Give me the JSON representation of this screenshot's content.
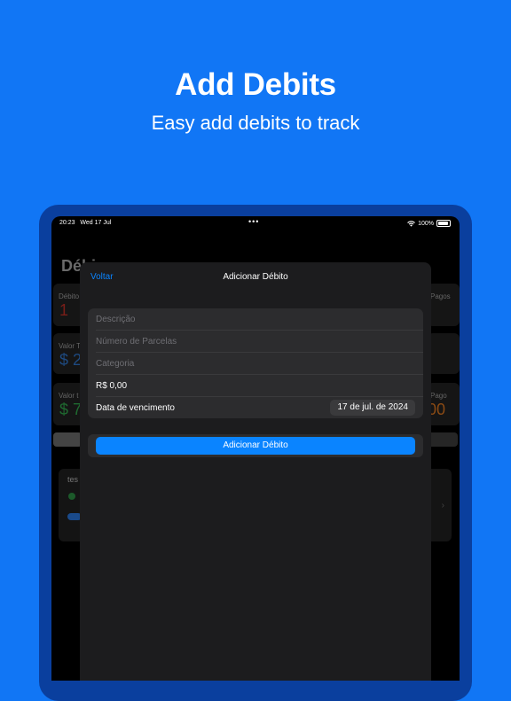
{
  "promo": {
    "title": "Add Debits",
    "subtitle": "Easy add debits to track"
  },
  "status_bar": {
    "time": "20:23",
    "date": "Wed 17 Jul",
    "dots": "•••",
    "battery": "100%"
  },
  "background_app": {
    "title_partial": "Débi",
    "card1_label": "Débito",
    "card1_value": "1",
    "card1_right_label": "Pagos",
    "card2_label": "Valor T",
    "card2_value": "$ 2",
    "card3_label": "Valor t",
    "card3_value": "$ 7",
    "card3_right_label": "Pago",
    "card3_right_value": "00",
    "item_name_partial": "tes"
  },
  "modal": {
    "back_label": "Voltar",
    "title": "Adicionar Débito",
    "fields": {
      "description_placeholder": "Descrição",
      "installments_placeholder": "Número de Parcelas",
      "category_placeholder": "Categoria",
      "amount_value": "R$ 0,00",
      "due_date_label": "Data de vencimento",
      "due_date_value": "17 de jul. de 2024"
    },
    "submit_label": "Adicionar Débito"
  },
  "colors": {
    "background": "#1176f5",
    "accent": "#0a84ff",
    "modal_bg": "#1c1c1e",
    "field_bg": "#2c2c2e"
  }
}
